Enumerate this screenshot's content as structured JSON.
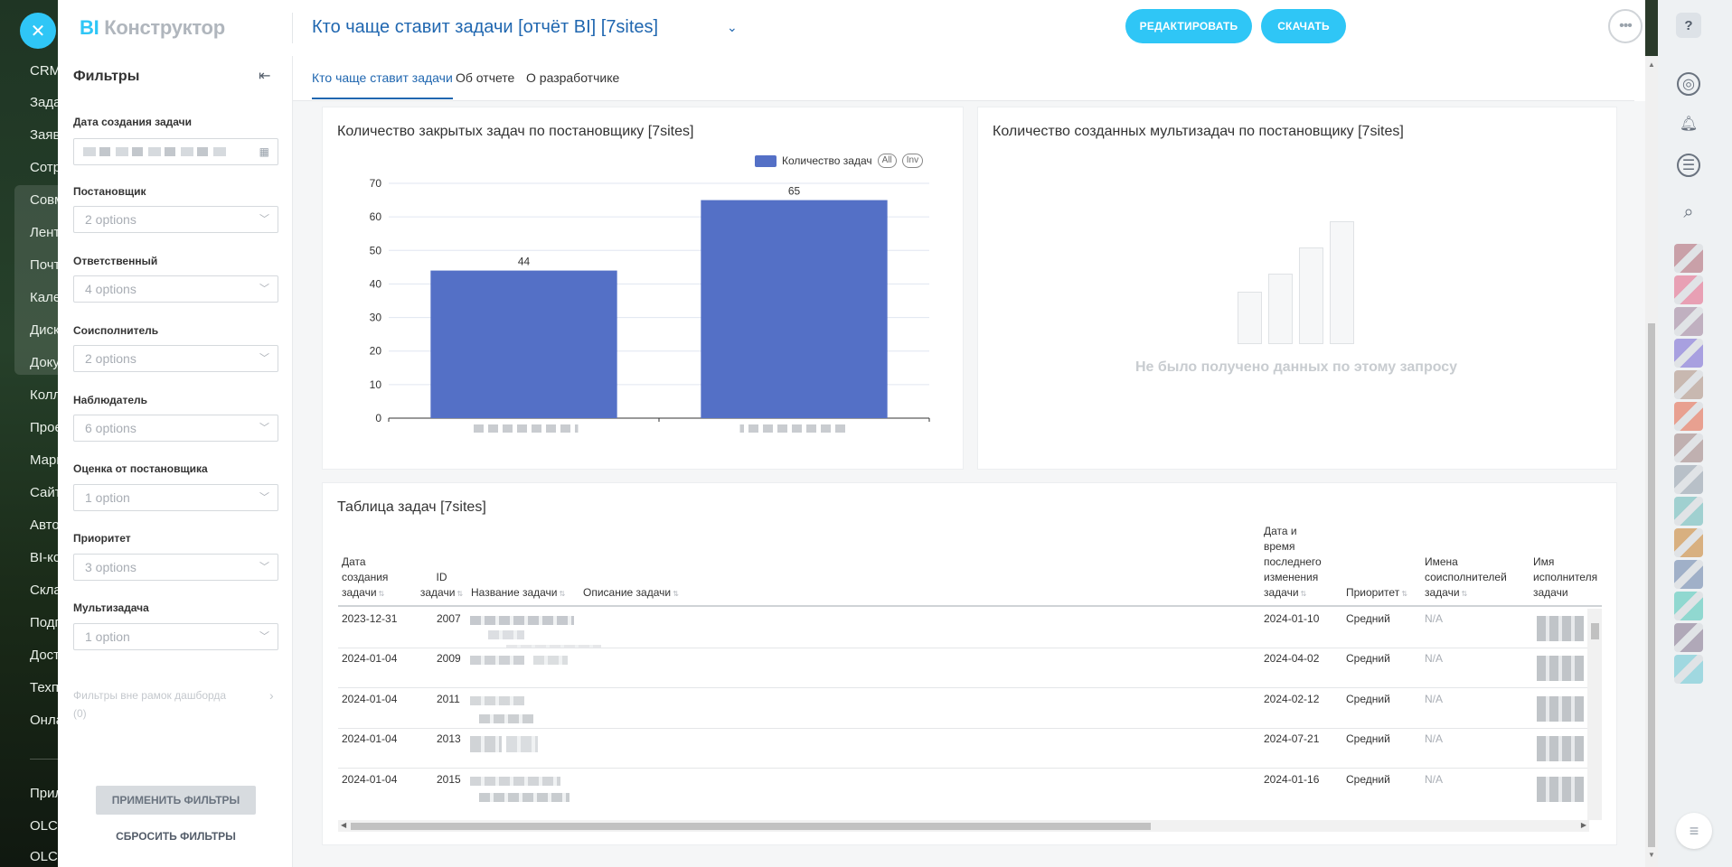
{
  "bg_menu": [
    "CRM",
    "Зада",
    "Заяв",
    "Сотр",
    "Совм",
    "Лент",
    "Почт",
    "Кале",
    "Диск",
    "Доку",
    "Колл",
    "Прое",
    "Марк",
    "Сайт",
    "Авто",
    "BI-ко",
    "Скла",
    "Подп",
    "Дост",
    "Техп",
    "Онла",
    "Прил",
    "OLCH",
    "OLCH"
  ],
  "close_icon": "✕",
  "header": {
    "logo_accent": "BI",
    "logo_rest": " Конструктор",
    "title": "Кто чаще ставит задачи [отчёт BI] [7sites]",
    "chevron": "⌄",
    "edit_label": "РЕДАКТИРОВАТЬ",
    "download_label": "СКАЧАТЬ",
    "more": "•••"
  },
  "sidebar": {
    "title": "Фильтры",
    "collapse_icon": "⇤",
    "filters": [
      {
        "label": "Дата создания задачи",
        "value": ""
      },
      {
        "label": "Постановщик",
        "value": "2 options"
      },
      {
        "label": "Ответственный",
        "value": "4 options"
      },
      {
        "label": "Соисполнитель",
        "value": "2 options"
      },
      {
        "label": "Наблюдатель",
        "value": "6 options"
      },
      {
        "label": "Оценка от постановщика",
        "value": "1 option"
      },
      {
        "label": "Приоритет",
        "value": "3 options"
      },
      {
        "label": "Мультизадача",
        "value": "1 option"
      }
    ],
    "outside_label": "Фильтры вне рамок дашборда",
    "outside_count": "(0)",
    "apply_label": "ПРИМЕНИТЬ ФИЛЬТРЫ",
    "reset_label": "СБРОСИТЬ ФИЛЬТРЫ"
  },
  "tabs": [
    {
      "label": "Кто чаще ставит задачи"
    },
    {
      "label": "Об отчете"
    },
    {
      "label": "О разработчике"
    }
  ],
  "chart1": {
    "title": "Количество закрытых задач по постановщику [7sites]",
    "legend_label": "Количество задач",
    "legend_all": "All",
    "legend_inv": "Inv"
  },
  "chart2": {
    "title": "Количество созданных мультизадач по постановщику [7sites]",
    "no_data": "Не было получено данных по этому запросу"
  },
  "chart_data": {
    "type": "bar",
    "categories": [
      "",
      ""
    ],
    "values": [
      44,
      65
    ],
    "ylim": [
      0,
      70
    ],
    "yticks": [
      0,
      10,
      20,
      30,
      40,
      50,
      60,
      70
    ],
    "color": "#5470c6",
    "legend": "top-right",
    "grid": true
  },
  "table": {
    "title": "Таблица задач [7sites]",
    "columns": [
      "Дата создания задачи",
      "ID задачи",
      "Название задачи",
      "Описание задачи",
      "Дата и время последнего изменения задачи",
      "Приоритет",
      "Имена соисполнителей задачи",
      "Имя исполнителя задачи"
    ],
    "rows": [
      {
        "date": "2023-12-31",
        "id": "2007",
        "changed": "2024-01-10",
        "priority": "Средний",
        "co": "N/A"
      },
      {
        "date": "2024-01-04",
        "id": "2009",
        "changed": "2024-04-02",
        "priority": "Средний",
        "co": "N/A"
      },
      {
        "date": "2024-01-04",
        "id": "2011",
        "changed": "2024-02-12",
        "priority": "Средний",
        "co": "N/A"
      },
      {
        "date": "2024-01-04",
        "id": "2013",
        "changed": "2024-07-21",
        "priority": "Средний",
        "co": "N/A"
      },
      {
        "date": "2024-01-04",
        "id": "2015",
        "changed": "2024-01-16",
        "priority": "Средний",
        "co": "N/A"
      }
    ]
  },
  "rail": {
    "help": "?",
    "search_icon": "⌕",
    "list_icon": "≡"
  },
  "colors": {
    "accent": "#2fc6f6",
    "link": "#2067b0",
    "bar": "#5470c6"
  }
}
